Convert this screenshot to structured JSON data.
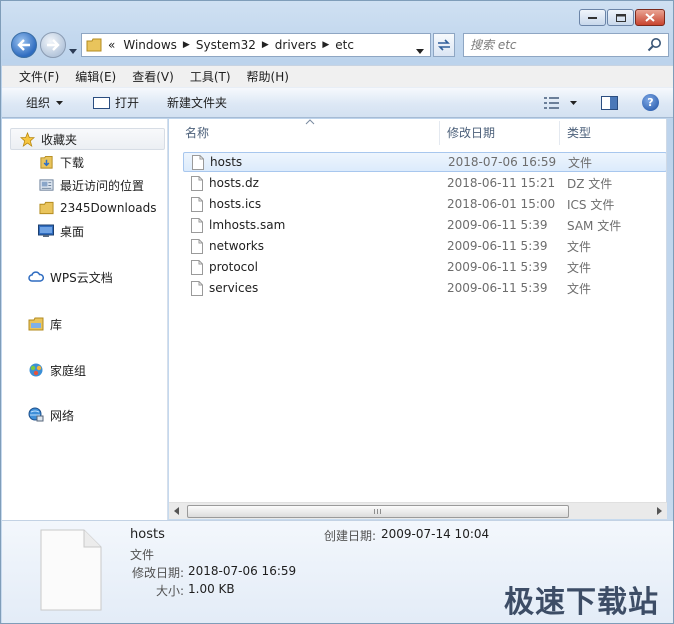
{
  "window": {
    "caption_buttons": [
      "minimize",
      "maximize",
      "close"
    ]
  },
  "address": {
    "overflow": "«",
    "crumbs": [
      "Windows",
      "System32",
      "drivers",
      "etc"
    ]
  },
  "search": {
    "placeholder": "搜索 etc"
  },
  "menu": [
    "文件(F)",
    "编辑(E)",
    "查看(V)",
    "工具(T)",
    "帮助(H)"
  ],
  "toolbar": {
    "organize": "组织",
    "open": "打开",
    "new_folder": "新建文件夹"
  },
  "nav": {
    "favorites": "收藏夹",
    "downloads": "下载",
    "recent": "最近访问的位置",
    "downloads2345": "2345Downloads",
    "desktop": "桌面",
    "wps": "WPS云文档",
    "libraries": "库",
    "homegroup": "家庭组",
    "network": "网络"
  },
  "columns": {
    "name": "名称",
    "date": "修改日期",
    "type": "类型"
  },
  "files": [
    {
      "name": "hosts",
      "date": "2018-07-06 16:59",
      "type": "文件",
      "selected": true
    },
    {
      "name": "hosts.dz",
      "date": "2018-06-11 15:21",
      "type": "DZ 文件",
      "selected": false
    },
    {
      "name": "hosts.ics",
      "date": "2018-06-01 15:00",
      "type": "ICS 文件",
      "selected": false
    },
    {
      "name": "lmhosts.sam",
      "date": "2009-06-11 5:39",
      "type": "SAM 文件",
      "selected": false
    },
    {
      "name": "networks",
      "date": "2009-06-11 5:39",
      "type": "文件",
      "selected": false
    },
    {
      "name": "protocol",
      "date": "2009-06-11 5:39",
      "type": "文件",
      "selected": false
    },
    {
      "name": "services",
      "date": "2009-06-11 5:39",
      "type": "文件",
      "selected": false
    }
  ],
  "scrollbar": {
    "grip": "III"
  },
  "details": {
    "name": "hosts",
    "type": "文件",
    "modified_label": "修改日期:",
    "modified": "2018-07-06 16:59",
    "size_label": "大小:",
    "size": "1.00 KB",
    "created_label": "创建日期:",
    "created": "2009-07-14 10:04"
  },
  "watermark": "极速下载站",
  "colors": {
    "selection": "#dcebfc",
    "chrome": "#c9dbef",
    "accent": "#2f6cc0"
  }
}
